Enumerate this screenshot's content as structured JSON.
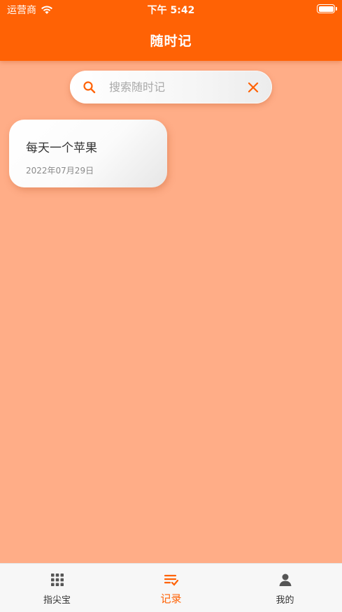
{
  "status_bar": {
    "carrier": "运营商",
    "time": "下午 5:42"
  },
  "header": {
    "title": "随时记"
  },
  "search": {
    "placeholder": "搜索随时记",
    "value": "",
    "icon": "search-icon",
    "clear_icon": "close-icon"
  },
  "notes": [
    {
      "title": "每天一个苹果",
      "date": "2022年07月29日"
    }
  ],
  "tabs": [
    {
      "label": "指尖宝",
      "icon": "grid-icon",
      "active": false
    },
    {
      "label": "记录",
      "icon": "list-check-icon",
      "active": true
    },
    {
      "label": "我的",
      "icon": "user-icon",
      "active": false
    }
  ],
  "colors": {
    "header": "#FF6205",
    "background": "#FFAD87",
    "accent": "#FF6205",
    "tabbar": "#F7F7F7"
  }
}
